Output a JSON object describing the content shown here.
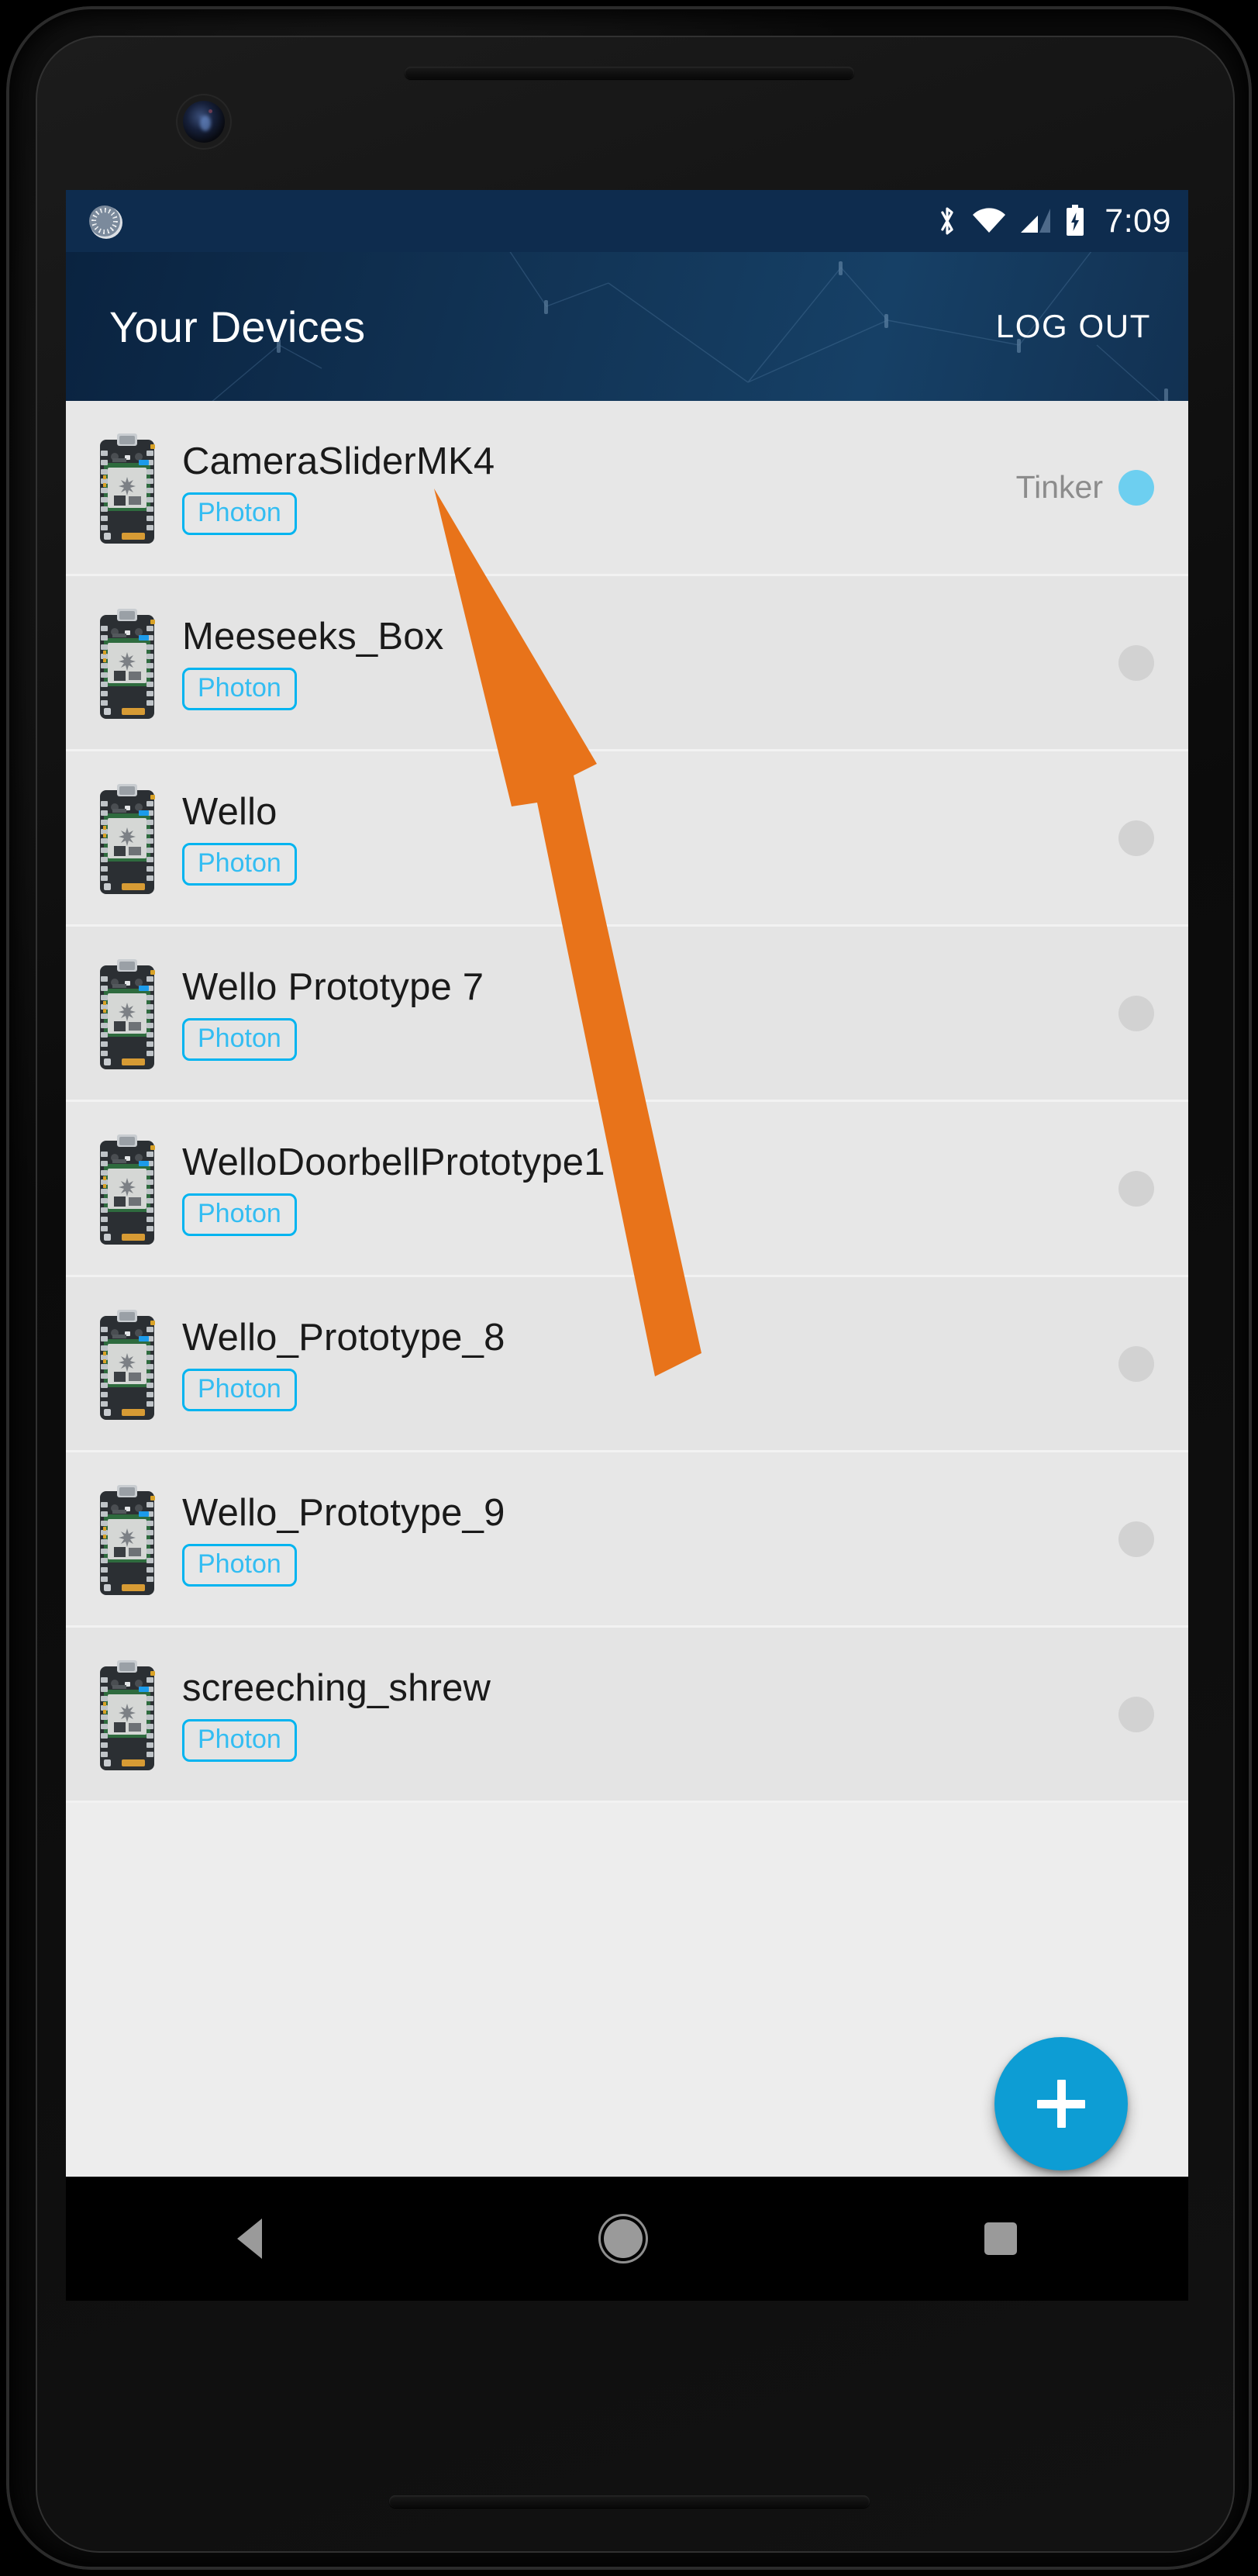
{
  "statusbar": {
    "time": "7:09",
    "icons": [
      "bluetooth-icon",
      "wifi-icon",
      "cellular-signal-icon",
      "battery-charging-icon"
    ],
    "app_icon": "particle-app-icon",
    "bg_color": "#0E2C4E"
  },
  "appbar": {
    "title": "Your Devices",
    "logout_label": "LOG OUT",
    "bg_color": "#123557"
  },
  "devices": [
    {
      "name": "CameraSliderMK4",
      "badge": "Photon",
      "mode": "Tinker",
      "online": true
    },
    {
      "name": "Meeseeks_Box",
      "badge": "Photon",
      "mode": "",
      "online": false
    },
    {
      "name": "Wello",
      "badge": "Photon",
      "mode": "",
      "online": false
    },
    {
      "name": "Wello Prototype 7",
      "badge": "Photon",
      "mode": "",
      "online": false
    },
    {
      "name": "WelloDoorbellPrototype1",
      "badge": "Photon",
      "mode": "",
      "online": false
    },
    {
      "name": "Wello_Prototype_8",
      "badge": "Photon",
      "mode": "",
      "online": false
    },
    {
      "name": "Wello_Prototype_9",
      "badge": "Photon",
      "mode": "",
      "online": false
    },
    {
      "name": "screeching_shrew",
      "badge": "Photon",
      "mode": "",
      "online": false
    }
  ],
  "fab": {
    "icon": "plus-icon",
    "color": "#0D9DD4"
  },
  "navbar": {
    "back": "back-icon",
    "home": "home-icon",
    "recents": "recents-icon"
  },
  "annotation": {
    "color": "#E8731A",
    "shape": "arrow",
    "points_to": "CameraSliderMK4"
  },
  "colors": {
    "accent_cyan": "#00B4F0",
    "badge_text": "#33BDF2",
    "status_online": "#6DCFF0",
    "status_offline": "#D2D2D2",
    "row_bg": "#E7E7E7",
    "screen_bg": "#EDEDED"
  }
}
